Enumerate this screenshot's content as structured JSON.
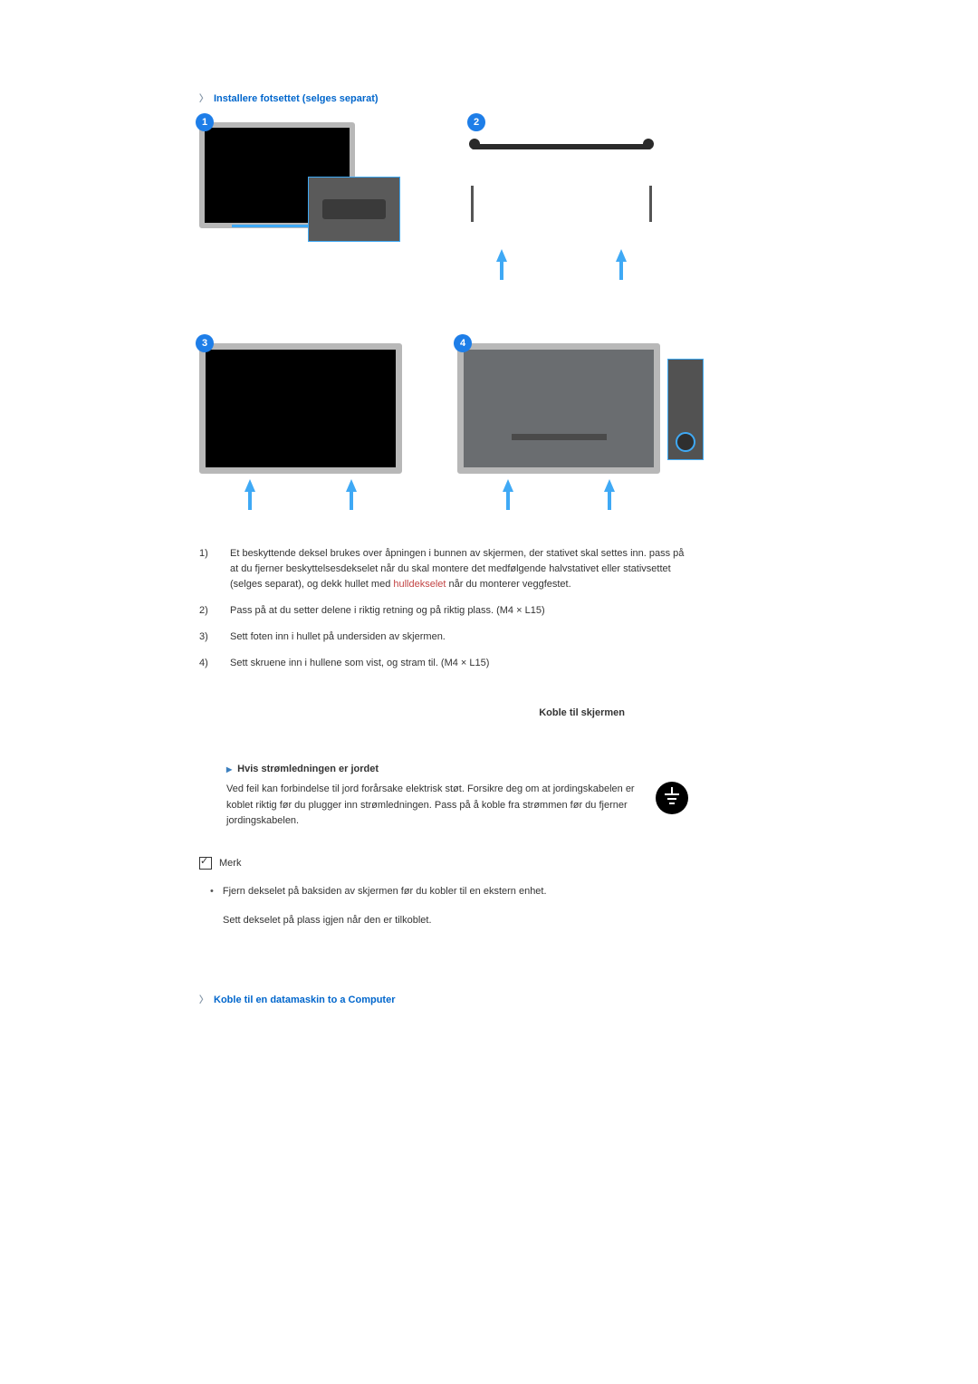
{
  "section1": {
    "heading": "Installere fotsettet (selges separat)",
    "badges": [
      "1",
      "2",
      "3",
      "4"
    ]
  },
  "steps": [
    {
      "num": "1)",
      "pre": "Et beskyttende deksel brukes over åpningen i bunnen av skjermen, der stativet skal settes inn. pass på at du fjerner beskyttelsesdekselet når du skal montere det medfølgende halvstativet eller stativsettet (selges separat), og dekk hullet med ",
      "link": "hulldekselet",
      "post": " når du monterer veggfestet."
    },
    {
      "num": "2)",
      "text": "Pass på at du setter delene i riktig retning og på riktig plass. (M4 × L15)"
    },
    {
      "num": "3)",
      "text": "Sett foten inn i hullet på undersiden av skjermen."
    },
    {
      "num": "4)",
      "text": "Sett skruene inn i hullene som vist, og stram til. (M4 × L15)"
    }
  ],
  "rightSub": "Koble til skjermen",
  "power": {
    "heading": "Hvis strømledningen er jordet",
    "text": "Ved feil kan forbindelse til jord forårsake elektrisk støt. Forsikre deg om at jordingskabelen er koblet riktig før du plugger inn strømledningen. Pass på å koble fra strømmen før du fjerner jordingskabelen."
  },
  "noteLabel": "Merk",
  "noteBullet": "Fjern dekselet på baksiden av skjermen før du kobler til en ekstern enhet.",
  "noteLine": "Sett dekselet på plass igjen når den er tilkoblet.",
  "section3": {
    "heading": "Koble til en datamaskin to a Computer"
  }
}
